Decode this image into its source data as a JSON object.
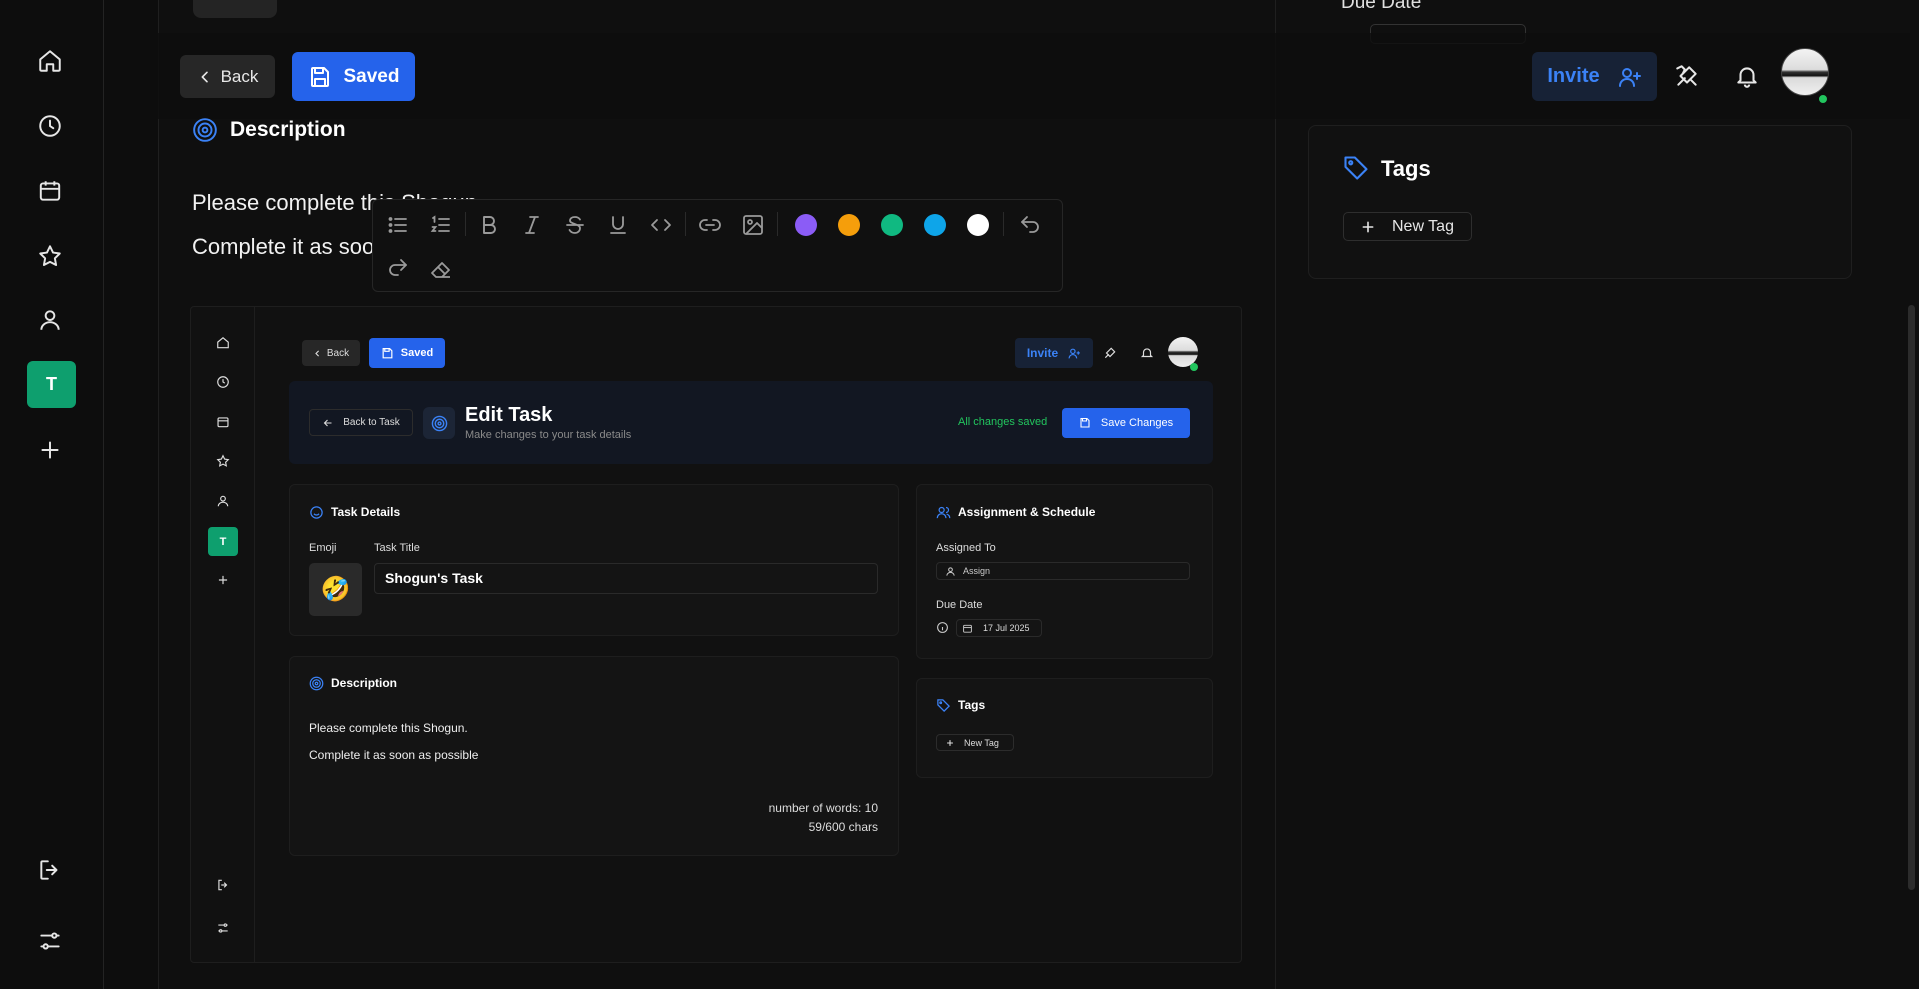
{
  "top_partial": {
    "due_date_label": "Due Date"
  },
  "header": {
    "back_label": "Back",
    "saved_label": "Saved",
    "invite_label": "Invite"
  },
  "description": {
    "title": "Description",
    "line1": "Please complete this Shogun.",
    "line2": "Complete it as soon as possible"
  },
  "editor_toolbar": {
    "colors": [
      "#8b5cf6",
      "#f59e0b",
      "#10b981",
      "#0ea5e9",
      "#ffffff"
    ]
  },
  "sidebar": {
    "team_letter": "T"
  },
  "tags_panel": {
    "title": "Tags",
    "new_tag_label": "New Tag"
  },
  "embedded": {
    "back_label": "Back",
    "saved_label": "Saved",
    "invite_label": "Invite",
    "team_letter": "T",
    "back_to_task_label": "Back to Task",
    "page_title": "Edit Task",
    "page_subtitle": "Make changes to your task details",
    "status_text": "All changes saved",
    "save_changes_label": "Save Changes",
    "task_details_title": "Task Details",
    "emoji_label": "Emoji",
    "emoji_value": "🤣",
    "task_title_label": "Task Title",
    "task_title_value": "Shogun's Task",
    "description_title": "Description",
    "description_line1": "Please complete this Shogun.",
    "description_line2": "Complete it as soon as possible",
    "word_count": "number of words: 10",
    "char_count": "59/600 chars",
    "assignment_title": "Assignment & Schedule",
    "assigned_to_label": "Assigned To",
    "assign_placeholder": "Assign",
    "due_date_label": "Due Date",
    "due_date_value": "17 Jul 2025",
    "tags_title": "Tags",
    "new_tag_label": "New Tag"
  },
  "colors": {
    "accent": "#2563eb",
    "success": "#0e9f6e",
    "status_green": "#22c55e"
  }
}
